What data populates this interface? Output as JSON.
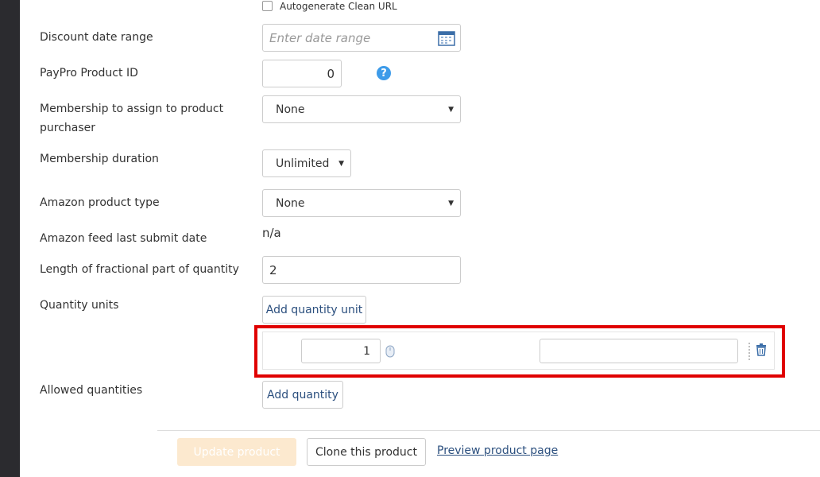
{
  "autogen": {
    "label": "Autogenerate Clean URL",
    "checked": false
  },
  "fields": {
    "discount_range": {
      "label": "Discount date range",
      "placeholder": "Enter date range"
    },
    "paypro_id": {
      "label": "PayPro Product ID",
      "value": "0"
    },
    "membership": {
      "label": "Membership to assign to product purchaser",
      "value": "None"
    },
    "membership_duration": {
      "label": "Membership duration",
      "value": "Unlimited"
    },
    "amazon_type": {
      "label": "Amazon product type",
      "value": "None"
    },
    "amazon_feed": {
      "label": "Amazon feed last submit date",
      "value": "n/a"
    },
    "fraction_length": {
      "label": "Length of fractional part of quantity",
      "value": "2"
    },
    "quantity_units": {
      "label": "Quantity units",
      "button": "Add quantity unit",
      "row_value": "1",
      "row_name": ""
    },
    "allowed_quantities": {
      "label": "Allowed quantities",
      "button": "Add quantity"
    }
  },
  "footer": {
    "update": "Update product",
    "clone": "Clone this product",
    "preview": "Preview product page"
  },
  "colors": {
    "accent_link": "#2b4f7e",
    "help_icon": "#3d9be9",
    "highlight": "#e00000",
    "update_disabled": "#fce9cf"
  }
}
